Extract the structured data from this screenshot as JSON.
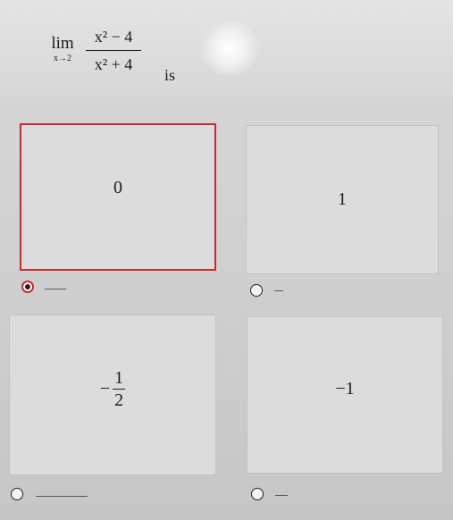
{
  "question": {
    "lim_word": "lim",
    "lim_sub": "x→2",
    "numerator": "x² − 4",
    "denominator": "x² + 4",
    "tail": "is"
  },
  "options": [
    {
      "id": "a",
      "text": "0",
      "selected": true
    },
    {
      "id": "b",
      "text": "1",
      "selected": false
    },
    {
      "id": "c",
      "sign": "−",
      "numerator": "1",
      "denominator": "2",
      "selected": false
    },
    {
      "id": "d",
      "text": "−1",
      "selected": false
    }
  ]
}
